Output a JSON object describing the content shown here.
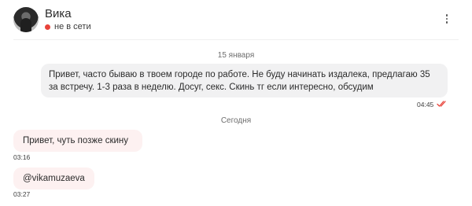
{
  "contact": {
    "name": "Вика",
    "status": "не в сети"
  },
  "messages": [
    {
      "date_divider": "15 января"
    },
    {
      "direction": "outgoing",
      "text": "Привет, часто бываю в твоем городе по работе. Не буду начинать издалека, предлагаю 35 за встречу. 1-3 раза в неделю. Досуг, секс. Скинь тг если интересно, обсудим",
      "time": "04:45"
    },
    {
      "date_divider": "Сегодня"
    },
    {
      "direction": "incoming",
      "text": "Привет, чуть позже скину",
      "time": "03:16"
    },
    {
      "direction": "incoming",
      "text": "@vikamuzaeva",
      "time": "03:27"
    }
  ],
  "colors": {
    "status_offline": "#e8433a",
    "outgoing_bubble": "#f1f1f2",
    "incoming_bubble": "#fdf1f1",
    "read_checks": "#e8433a"
  },
  "icons": {
    "menu": "vertical-dots-icon",
    "read_status": "double-check-icon"
  }
}
